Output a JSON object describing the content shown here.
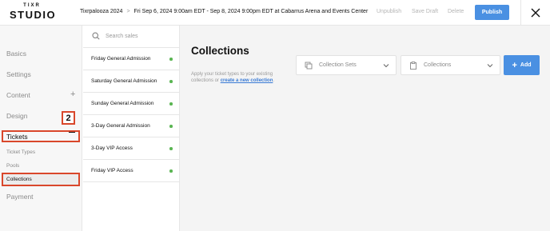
{
  "brand": {
    "top": "TIXR",
    "bottom": "STUDIO"
  },
  "header": {
    "event_name": "Tixrpalooza 2024",
    "separator": ">",
    "event_details": "Fri Sep 6, 2024 9:00am EDT - Sep 8, 2024 9:00pm EDT at Cabarrus Arena and Events Center",
    "unpublish": "Unpublish",
    "save_draft": "Save Draft",
    "delete": "Delete",
    "publish": "Publish"
  },
  "sidebar": {
    "items": [
      {
        "label": "Basics"
      },
      {
        "label": "Settings"
      },
      {
        "label": "Content"
      },
      {
        "label": "Design"
      },
      {
        "label": "Tickets"
      },
      {
        "label": "Payment"
      }
    ],
    "sub_items": [
      {
        "label": "Ticket Types"
      },
      {
        "label": "Pools"
      },
      {
        "label": "Collections"
      }
    ],
    "step_badge": "2"
  },
  "list": {
    "search_placeholder": "Search sales",
    "rows": [
      {
        "label": "Friday General Admission"
      },
      {
        "label": "Saturday General Admission"
      },
      {
        "label": "Sunday General Admission"
      },
      {
        "label": "3-Day General Admission"
      },
      {
        "label": "3-Day VIP Access"
      },
      {
        "label": "Friday VIP Access"
      }
    ]
  },
  "main": {
    "title": "Collections",
    "desc_text": "Apply your ticket types to your existing collections or",
    "desc_link": "create a new collection",
    "desc_end": ".",
    "collection_sets": "Collection Sets",
    "collections": "Collections",
    "add": "Add"
  },
  "colors": {
    "accent": "#4a90e2",
    "highlight": "#d9472b",
    "status_dot": "#5ab552"
  }
}
